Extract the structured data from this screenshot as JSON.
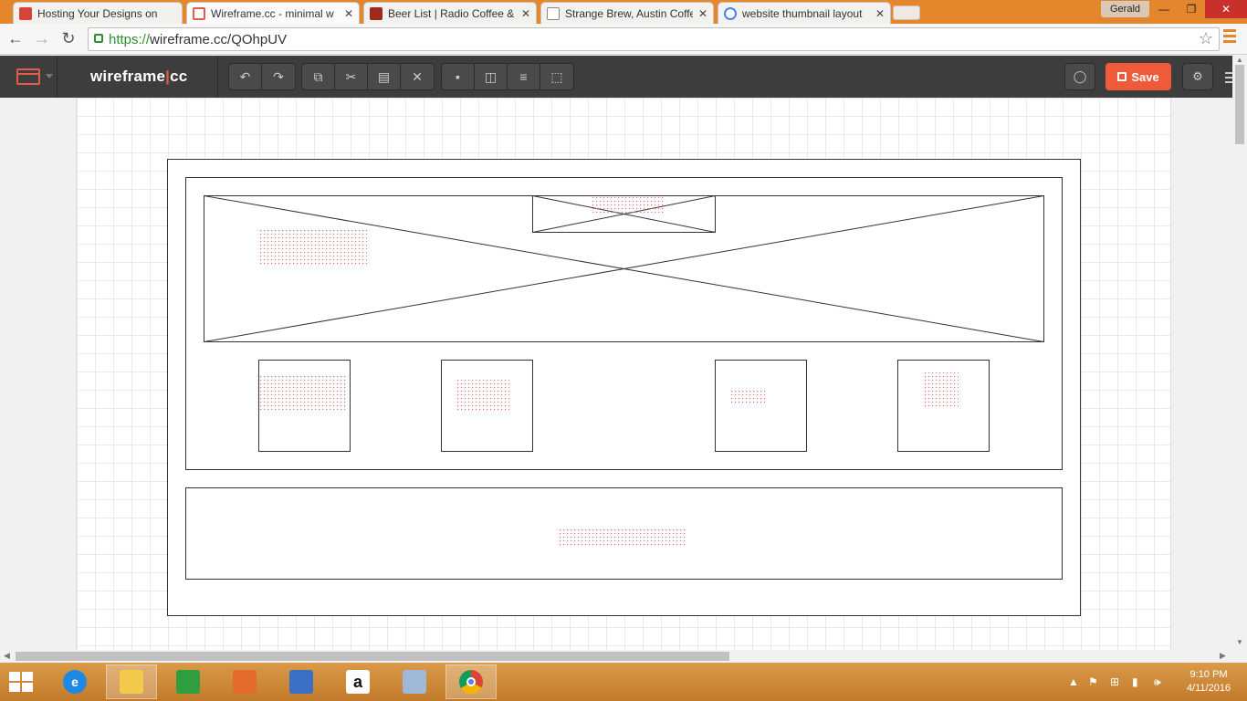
{
  "browser": {
    "tabs": [
      {
        "title": "Hosting Your Designs on",
        "active": false,
        "favicon_color": "#d9443a"
      },
      {
        "title": "Wireframe.cc - minimal w",
        "active": true,
        "favicon_color": "#e25c46"
      },
      {
        "title": "Beer List | Radio Coffee &",
        "active": false,
        "favicon_color": "#a0281d"
      },
      {
        "title": "Strange Brew, Austin Coffe",
        "active": false,
        "favicon_color": "#ffffff"
      },
      {
        "title": "website thumbnail layout",
        "active": false,
        "favicon_color": "#4285f4"
      }
    ],
    "user": "Gerald",
    "url_scheme": "https://",
    "url_rest": "wireframe.cc/QOhpUV"
  },
  "app": {
    "brand_left": "wireframe",
    "brand_sep": "|",
    "brand_right": "cc",
    "save_label": "Save",
    "accent": "#ee5a3a"
  },
  "taskbar": {
    "time": "9:10 PM",
    "date": "4/11/2016"
  }
}
